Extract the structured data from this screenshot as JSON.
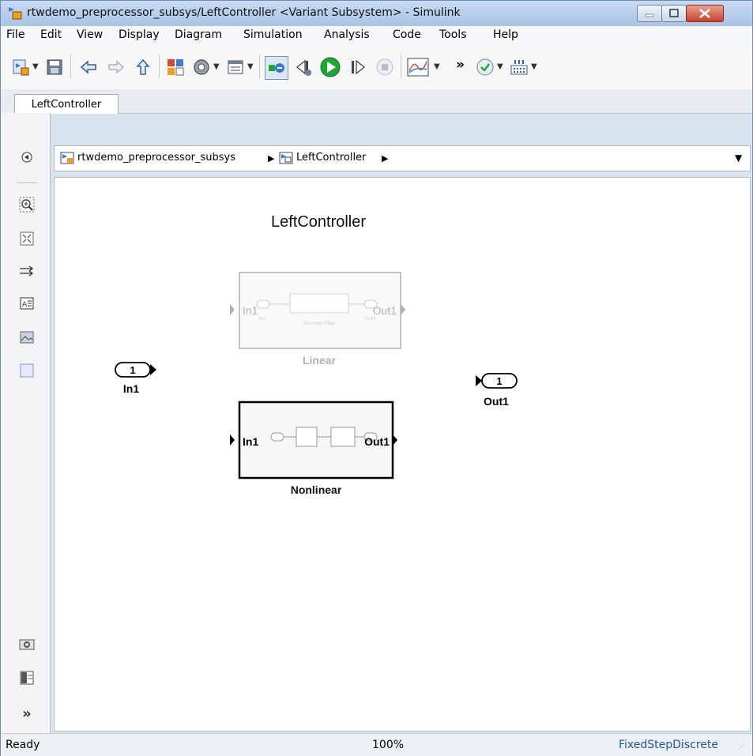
{
  "window": {
    "title": "rtwdemo_preprocessor_subsys/LeftController  <Variant Subsystem> - Simulink"
  },
  "menu": [
    "File",
    "Edit",
    "View",
    "Display",
    "Diagram",
    "Simulation",
    "Analysis",
    "Code",
    "Tools",
    "Help"
  ],
  "toolbar": {
    "icons": [
      "new-model-icon",
      "save-icon",
      "back-icon",
      "forward-icon",
      "up-icon",
      "library-browser-icon",
      "model-config-icon",
      "model-explorer-icon",
      "update-diagram-icon",
      "step-back-icon",
      "run-icon",
      "step-forward-icon",
      "stop-icon",
      "data-inspector-icon",
      "more-icon",
      "model-advisor-icon",
      "build-icon"
    ]
  },
  "tabs": {
    "active": "LeftController"
  },
  "breadcrumb": {
    "root": "rtwdemo_preprocessor_subsys",
    "child": "LeftController"
  },
  "canvas": {
    "title": "LeftController",
    "inport": {
      "number": "1",
      "label": "In1"
    },
    "outport": {
      "number": "1",
      "label": "Out1"
    },
    "blocks": [
      {
        "name": "Linear",
        "in": "In1",
        "out": "Out1",
        "inner": "Discrete Filter",
        "inner_in": "In1",
        "inner_out": "Out1",
        "active": false
      },
      {
        "name": "Nonlinear",
        "in": "In1",
        "out": "Out1",
        "active": true
      }
    ]
  },
  "status": {
    "left": "Ready",
    "zoom": "100%",
    "solver": "FixedStepDiscrete"
  },
  "colors": {
    "title_gradient": "#b5cdea",
    "close_button": "#c8412b",
    "run_green": "#1fa637",
    "solver_link": "#1a55b0"
  }
}
